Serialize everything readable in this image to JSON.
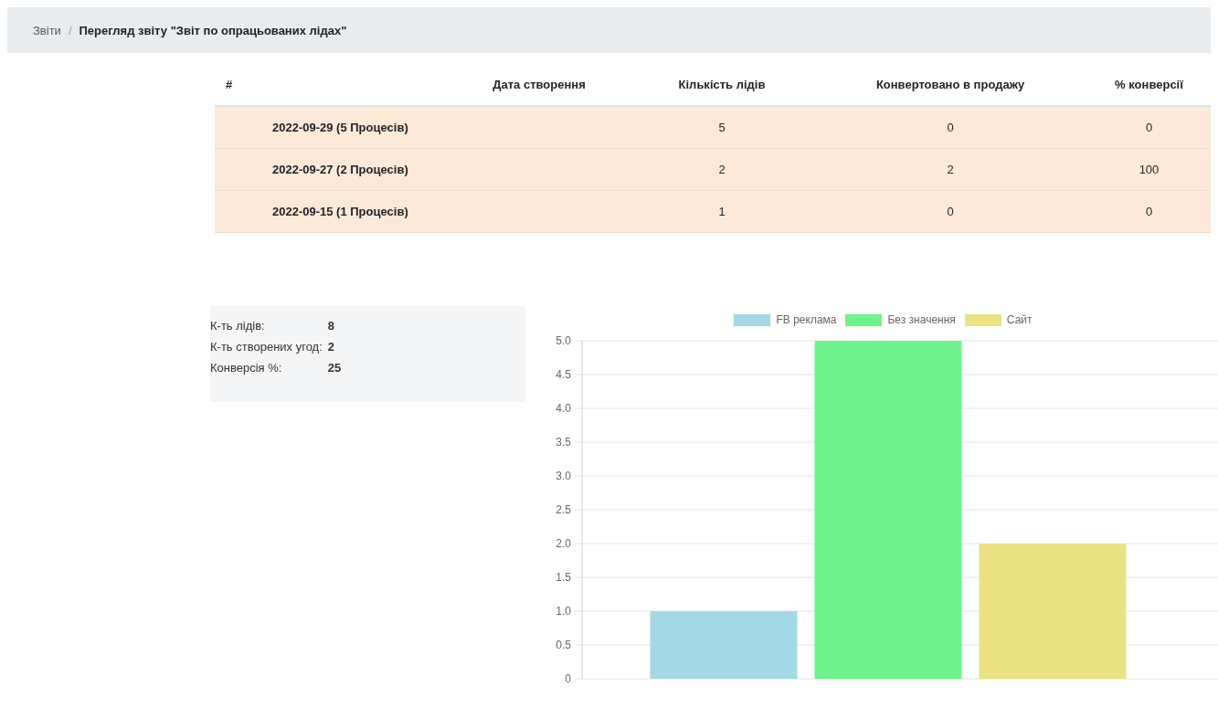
{
  "breadcrumb": {
    "items": [
      "Звіти",
      "Перегляд звіту \"Звіт по опрацьованих лідах\""
    ],
    "separator": "/"
  },
  "table": {
    "columns": [
      "#",
      "Дата створення",
      "Кількість лідів",
      "Конвертовано в продажу",
      "% конверсії"
    ],
    "rows": [
      {
        "group": "2022-09-29 (5 Процесів)",
        "leads": "5",
        "converted": "0",
        "conversion": "0"
      },
      {
        "group": "2022-09-27 (2 Процесів)",
        "leads": "2",
        "converted": "2",
        "conversion": "100"
      },
      {
        "group": "2022-09-15 (1 Процесів)",
        "leads": "1",
        "converted": "0",
        "conversion": "0"
      }
    ]
  },
  "summary": [
    {
      "label": "К-ть лідів:",
      "value": "8"
    },
    {
      "label": "К-ть створених угод:",
      "value": "2"
    },
    {
      "label": "Конверсія %:",
      "value": "25"
    }
  ],
  "chart": {
    "chart_data": {
      "type": "bar",
      "categories": [
        null
      ],
      "grid": true,
      "legend": true,
      "series": [
        {
          "name": "FB реклама",
          "color": "#a5d8e6",
          "values": [
            1
          ]
        },
        {
          "name": "Без значення",
          "color": "#6ff48d",
          "values": [
            5
          ]
        },
        {
          "name": "Сайт",
          "color": "#ebe383",
          "values": [
            2
          ]
        }
      ],
      "ylim": [
        0,
        5
      ],
      "yticks": [
        {
          "value": 0,
          "label": "0"
        },
        0.5,
        {
          "value": 1,
          "label": "1.0"
        },
        1.5,
        {
          "value": 2,
          "label": "2.0"
        },
        2.5,
        {
          "value": 3,
          "label": "3.0"
        },
        3.5,
        {
          "value": 4,
          "label": "4.0"
        },
        4.5,
        {
          "value": 5,
          "label": "5.0"
        }
      ]
    }
  }
}
